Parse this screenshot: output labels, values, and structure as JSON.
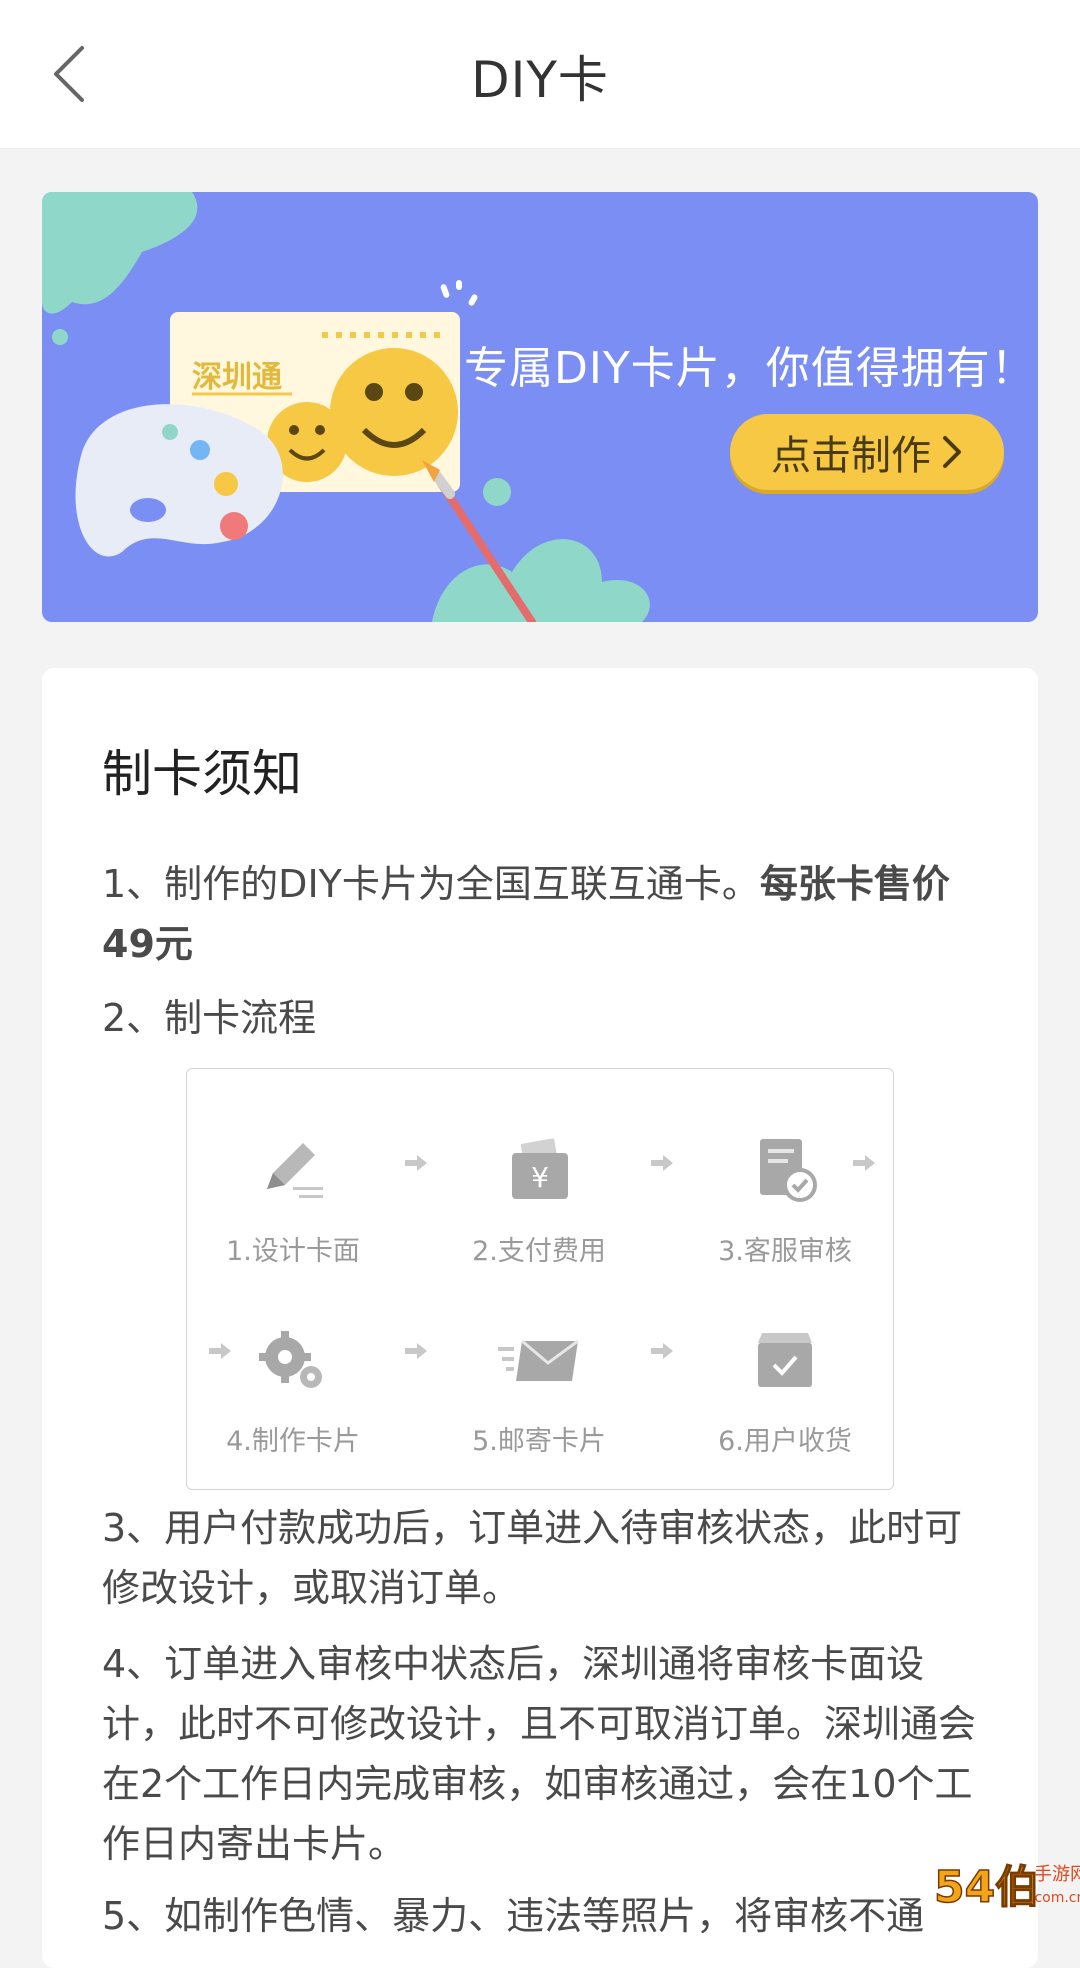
{
  "header": {
    "title": "DIY卡"
  },
  "banner": {
    "slogan": "专属DIY卡片，你值得拥有！",
    "cta": "点击制作",
    "card_brand": "深圳通",
    "colors": {
      "bg": "#7b8ef3",
      "button": "#f6c843",
      "splash": "#8fd8c9"
    }
  },
  "notice": {
    "title": "制卡须知",
    "item1_text": "1、制作的DIY卡片为全国互联互通卡。",
    "item1_bold": "每张卡售价49元",
    "item2": "2、制卡流程",
    "steps": [
      {
        "label": "1.设计卡面",
        "icon": "pencil-icon"
      },
      {
        "label": "2.支付费用",
        "icon": "wallet-icon"
      },
      {
        "label": "3.客服审核",
        "icon": "review-check-icon"
      },
      {
        "label": "4.制作卡片",
        "icon": "gears-icon"
      },
      {
        "label": "5.邮寄卡片",
        "icon": "envelope-icon"
      },
      {
        "label": "6.用户收货",
        "icon": "box-check-icon"
      }
    ],
    "item3": "3、用户付款成功后，订单进入待审核状态，此时可修改设计，或取消订单。",
    "item4": "4、订单进入审核中状态后，深圳通将审核卡面设计，此时不可修改设计，且不可取消订单。深圳通会在2个工作日内完成审核，如审核通过，会在10个工作日内寄出卡片。",
    "item5": "5、如制作色情、暴力、违法等照片，将审核不通"
  },
  "watermark": {
    "text": "54伯",
    "sub": "手游网",
    "domain": ".com.cn"
  }
}
